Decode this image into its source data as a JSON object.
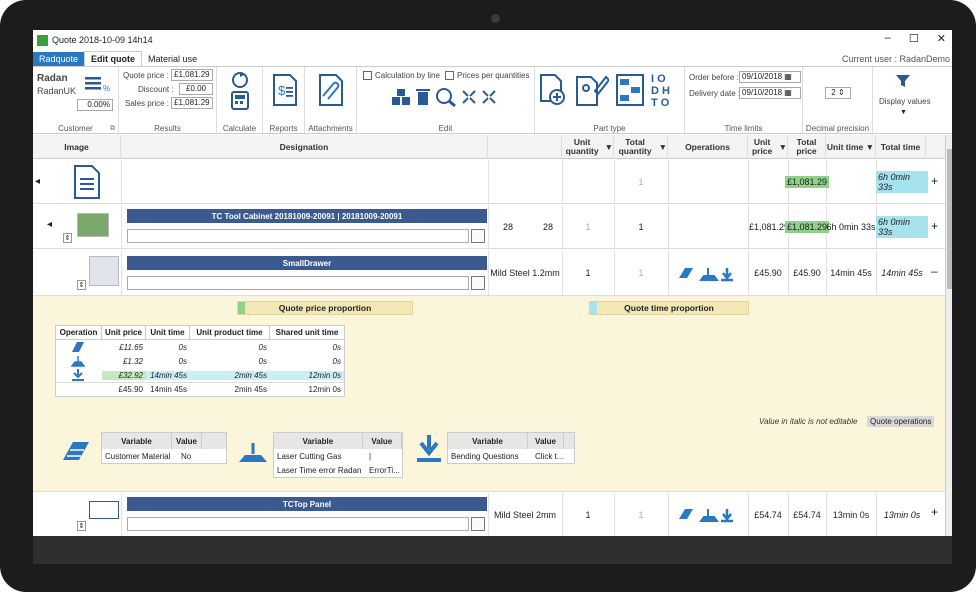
{
  "window": {
    "title": "Quote 2018-10-09 14h14",
    "min": "–",
    "max": "☐",
    "close": "✕"
  },
  "tabs": [
    {
      "label": "Radquote"
    },
    {
      "label": "Edit quote"
    },
    {
      "label": "Material use"
    }
  ],
  "current_user": "Current user : RadanDemo",
  "ribbon": {
    "customer": {
      "name": "Radan",
      "sub": "RadanUK",
      "percent": "0.00%",
      "group_label": "Customer"
    },
    "results": {
      "quote_price_label": "Quote price :",
      "quote_price": "£1,081.29",
      "discount_label": "Discount :",
      "discount": "£0.00",
      "sales_price_label": "Sales price :",
      "sales_price": "£1,081.29",
      "group_label": "Results"
    },
    "calculate": "Calculate",
    "reports": "Reports",
    "attachments": "Attachments",
    "edit": {
      "calc_by_line": "Calculation by line",
      "prices_per_qty": "Prices per quantities",
      "group_label": "Edit"
    },
    "part_type": {
      "group_label": "Part type"
    },
    "time_limits": {
      "order_before_label": "Order before :",
      "order_before": "09/10/2018",
      "delivery_label": "Delivery date :",
      "delivery": "09/10/2018",
      "group_label": "Time limits"
    },
    "decimal": {
      "value": "2",
      "group_label": "Decimal precision"
    },
    "display_values": "Display values"
  },
  "grid": {
    "headers": {
      "image": "Image",
      "designation": "Designation",
      "unit_qty": "Unit quantity",
      "total_qty": "Total quantity",
      "operations": "Operations",
      "unit_price": "Unit price",
      "total_price": "Total price",
      "unit_time": "Unit time",
      "total_time": "Total time"
    },
    "rows": [
      {
        "total_qty": "1",
        "total_price": "£1,081.29",
        "total_time": "6h 0min 33s",
        "action": "+"
      },
      {
        "title": "TC Tool Cabinet 20181009-20091 | 20181009-20091",
        "col_a": "28",
        "col_b": "28",
        "unit_qty": "1",
        "total_qty": "1",
        "unit_price": "£1,081.29",
        "total_price": "£1,081.29",
        "unit_time": "6h 0min 33s",
        "total_time": "6h 0min 33s",
        "action": "+"
      },
      {
        "title": "SmallDrawer",
        "material": "Mild Steel 1.2mm",
        "unit_qty": "1",
        "total_qty": "1",
        "unit_price": "£45.90",
        "total_price": "£45.90",
        "unit_time": "14min 45s",
        "total_time": "14min 45s",
        "action": "–"
      },
      {
        "title": "TCTop Panel",
        "material": "Mild Steel 2mm",
        "unit_qty": "1",
        "total_qty": "1",
        "unit_price": "£54.74",
        "total_price": "£54.74",
        "unit_time": "13min 0s",
        "total_time": "13min 0s",
        "action": "+"
      }
    ]
  },
  "detail": {
    "quote_price_proportion": "Quote price proportion",
    "quote_time_proportion": "Quote time proportion",
    "op_headers": [
      "Operation",
      "Unit price",
      "Unit time",
      "Unit product time",
      "Shared unit time"
    ],
    "op_rows": [
      {
        "unit_price": "£11.65",
        "unit_time": "0s",
        "product_time": "0s",
        "shared_time": "0s"
      },
      {
        "unit_price": "£1.32",
        "unit_time": "0s",
        "product_time": "0s",
        "shared_time": "0s"
      },
      {
        "unit_price": "£32.92",
        "unit_time": "14min 45s",
        "product_time": "2min 45s",
        "shared_time": "12min 0s"
      }
    ],
    "op_total": {
      "unit_price": "£45.90",
      "unit_time": "14min 45s",
      "product_time": "2min 45s",
      "shared_time": "12min 0s"
    },
    "note": "Value in italic is not editable",
    "quote_ops": "Quote operations",
    "vars": [
      {
        "h1": "Variable",
        "h2": "Value",
        "rows": [
          [
            "Customer Material",
            "No"
          ]
        ]
      },
      {
        "h1": "Variable",
        "h2": "Value",
        "rows": [
          [
            "Laser Cutting Gas",
            "|"
          ],
          [
            "Laser Time error Radan",
            "ErrorTi..."
          ]
        ]
      },
      {
        "h1": "Variable",
        "h2": "Value",
        "rows": [
          [
            "Bending Questions",
            "Click t..."
          ]
        ]
      }
    ]
  },
  "colors": {
    "accent": "#2a78c4",
    "banner": "#3b5a8f",
    "green": "#8fd08a",
    "cyan": "#a6e3ee",
    "panel": "#fbf5dc"
  }
}
